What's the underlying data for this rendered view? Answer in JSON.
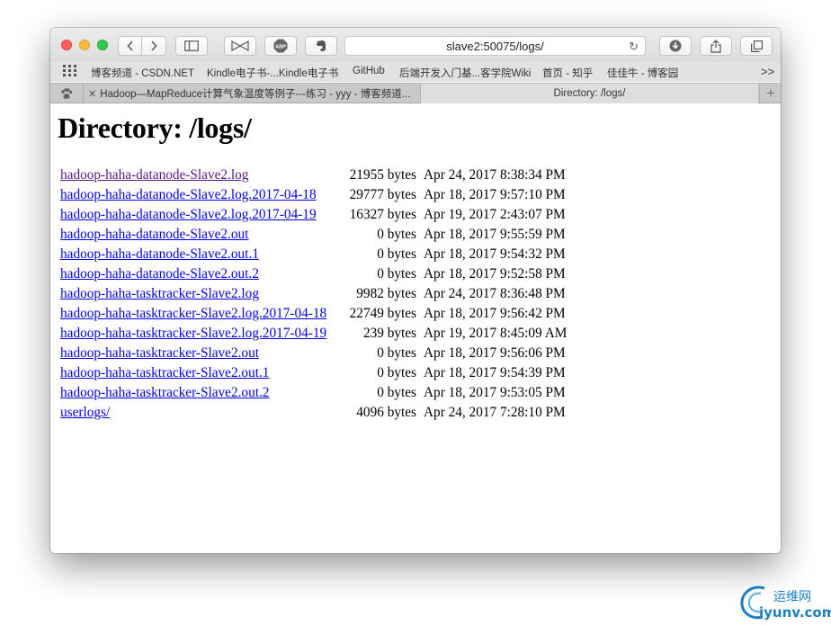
{
  "address": {
    "url": "slave2:50075/logs/"
  },
  "bookmarks": [
    "博客频道 - CSDN.NET",
    "Kindle电子书-...Kindle电子书",
    "GitHub",
    "后端开发入门基...客学院Wiki",
    "首页 - 知乎",
    "佳佳牛 - 博客园"
  ],
  "bookmarks_overflow": ">>",
  "tabs": [
    {
      "label": "Hadoop—MapReduce计算气象温度等例子---练习 - yyy - 博客频道...",
      "close": "✕"
    },
    {
      "label": "Directory: /logs/"
    }
  ],
  "page": {
    "heading": "Directory: /logs/",
    "files": [
      {
        "name": "hadoop-haha-datanode-Slave2.log ",
        "size": "21955 bytes",
        "date": "Apr 24, 2017 8:38:34 PM",
        "visited": true
      },
      {
        "name": "hadoop-haha-datanode-Slave2.log.2017-04-18 ",
        "size": "29777 bytes",
        "date": "Apr 18, 2017 9:57:10 PM"
      },
      {
        "name": "hadoop-haha-datanode-Slave2.log.2017-04-19 ",
        "size": "16327 bytes",
        "date": "Apr 19, 2017 2:43:07 PM"
      },
      {
        "name": "hadoop-haha-datanode-Slave2.out ",
        "size": "0 bytes",
        "date": "Apr 18, 2017 9:55:59 PM"
      },
      {
        "name": "hadoop-haha-datanode-Slave2.out.1 ",
        "size": "0 bytes",
        "date": "Apr 18, 2017 9:54:32 PM"
      },
      {
        "name": "hadoop-haha-datanode-Slave2.out.2 ",
        "size": "0 bytes",
        "date": "Apr 18, 2017 9:52:58 PM"
      },
      {
        "name": "hadoop-haha-tasktracker-Slave2.log ",
        "size": "9982 bytes",
        "date": "Apr 24, 2017 8:36:48 PM"
      },
      {
        "name": "hadoop-haha-tasktracker-Slave2.log.2017-04-18 ",
        "size": "22749 bytes",
        "date": "Apr 18, 2017 9:56:42 PM"
      },
      {
        "name": "hadoop-haha-tasktracker-Slave2.log.2017-04-19 ",
        "size": "239 bytes",
        "date": "Apr 19, 2017 8:45:09 AM"
      },
      {
        "name": "hadoop-haha-tasktracker-Slave2.out ",
        "size": "0 bytes",
        "date": "Apr 18, 2017 9:56:06 PM"
      },
      {
        "name": "hadoop-haha-tasktracker-Slave2.out.1 ",
        "size": "0 bytes",
        "date": "Apr 18, 2017 9:54:39 PM"
      },
      {
        "name": "hadoop-haha-tasktracker-Slave2.out.2 ",
        "size": "0 bytes",
        "date": "Apr 18, 2017 9:53:05 PM"
      },
      {
        "name": "userlogs/ ",
        "size": "4096 bytes",
        "date": "Apr 24, 2017 7:28:10 PM"
      }
    ]
  },
  "watermark": {
    "cn": "运维网",
    "en": "iyunv.com"
  }
}
